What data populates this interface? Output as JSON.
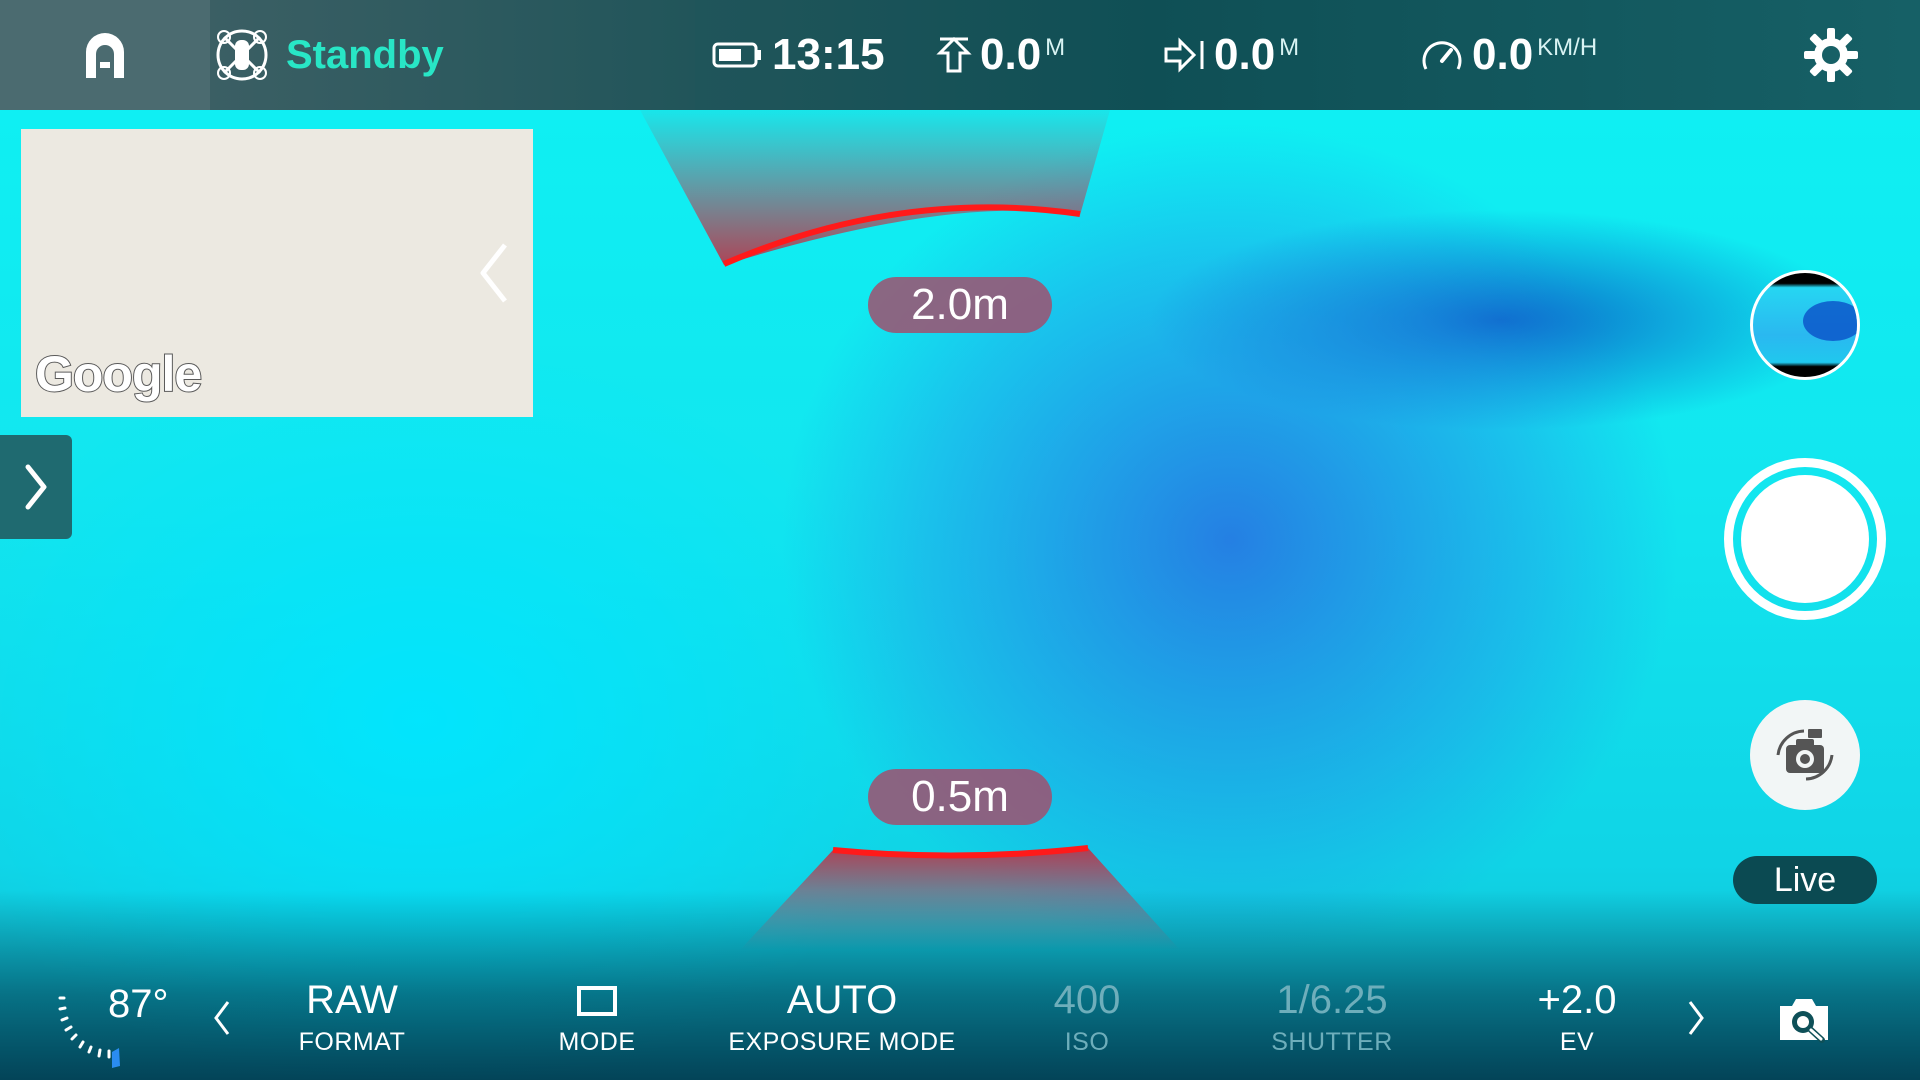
{
  "status": {
    "label": "Standby",
    "color": "#28e6c6"
  },
  "telemetry": {
    "battery_time": "13:15",
    "altitude": {
      "value": "0.0",
      "unit": "M"
    },
    "distance": {
      "value": "0.0",
      "unit": "M"
    },
    "speed": {
      "value": "0.0",
      "unit": "KM/H"
    }
  },
  "minimap": {
    "provider_logo": "Google"
  },
  "obstacle": {
    "front_distance": "2.0m",
    "rear_distance": "0.5m",
    "warning_color": "#ff1a1a"
  },
  "controls": {
    "live_label": "Live"
  },
  "bottom": {
    "gimbal_pitch": "87°",
    "params": [
      {
        "value": "RAW",
        "label": "FORMAT",
        "enabled": true
      },
      {
        "value": "",
        "label": "MODE",
        "enabled": true
      },
      {
        "value": "AUTO",
        "label": "EXPOSURE MODE",
        "enabled": true
      },
      {
        "value": "400",
        "label": "ISO",
        "enabled": false
      },
      {
        "value": "1/6.25",
        "label": "SHUTTER",
        "enabled": false
      },
      {
        "value": "+2.0",
        "label": "EV",
        "enabled": true
      }
    ]
  },
  "icons": {
    "home": "home-arch-icon",
    "drone": "drone-status-icon",
    "battery": "battery-icon",
    "altitude": "altitude-icon",
    "distance": "distance-icon",
    "speed": "speedometer-icon",
    "settings": "gear-icon",
    "camera_switch": "camera-switch-icon",
    "capture_settings": "camera-settings-icon"
  }
}
